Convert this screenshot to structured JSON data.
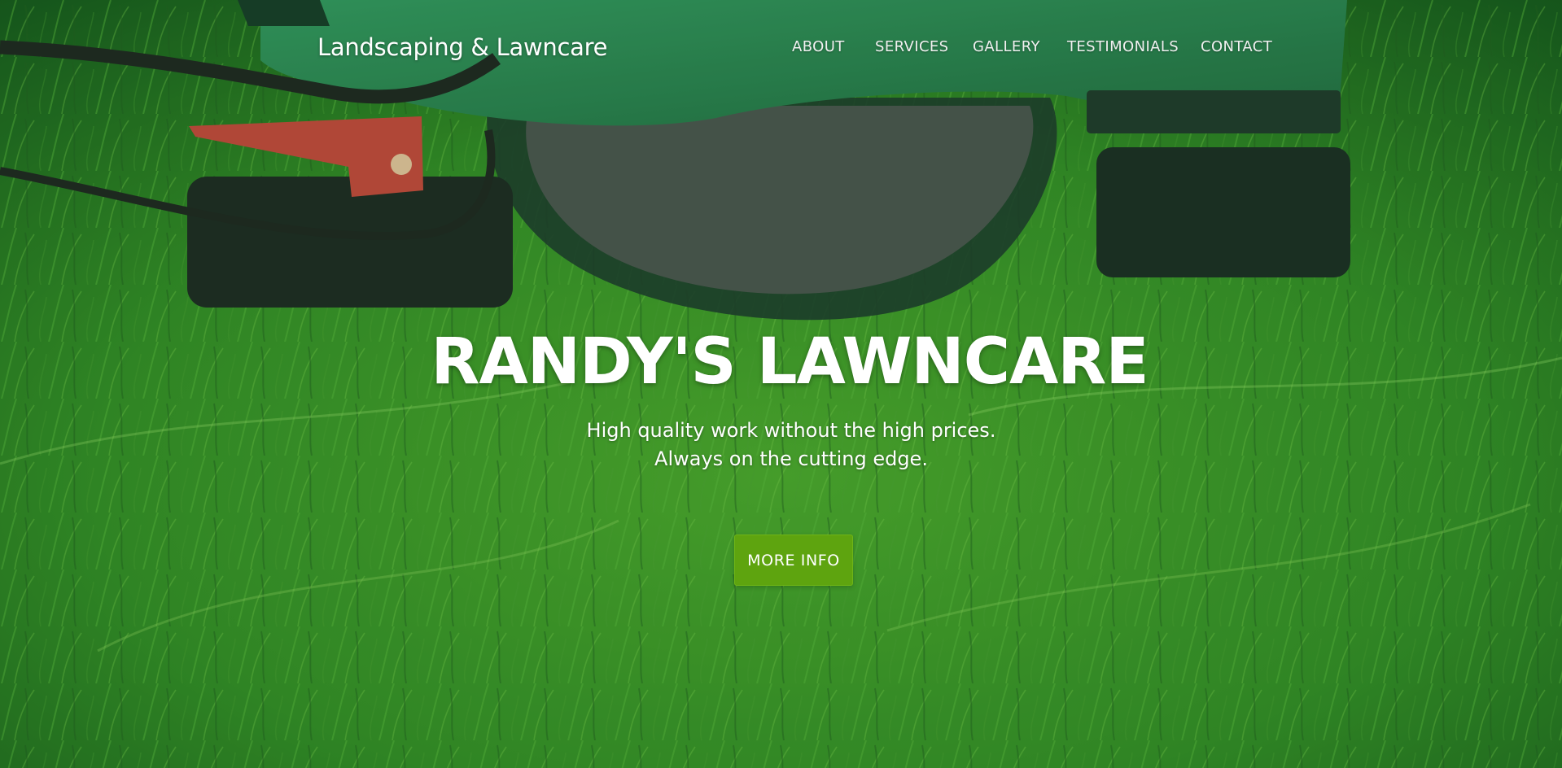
{
  "navbar": {
    "brand": "Landscaping & Lawncare",
    "links": [
      {
        "label": "ABOUT"
      },
      {
        "label": "SERVICES"
      },
      {
        "label": "GALLERY"
      },
      {
        "label": "TESTIMONIALS"
      },
      {
        "label": "CONTACT"
      }
    ]
  },
  "hero": {
    "title": "RANDY'S LAWNCARE",
    "subtitle_lines": [
      "High quality work without the high prices.",
      "Always on the cutting edge."
    ],
    "button_label": "MORE INFO"
  },
  "colors": {
    "grass": "#2f7a22",
    "mower_body": "#2d8a54",
    "mower_handle": "#c8493d",
    "button": "#5ea40f",
    "text": "#ffffff"
  }
}
